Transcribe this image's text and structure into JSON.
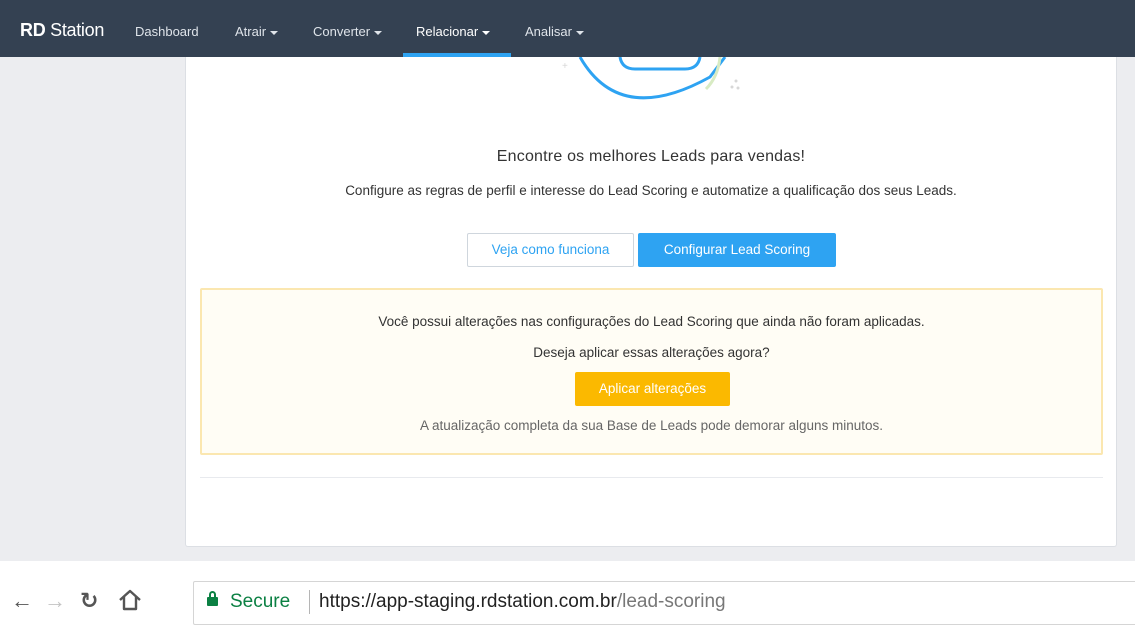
{
  "nav": {
    "brand_bold": "RD",
    "brand_rest": "Station",
    "items": [
      {
        "label": "Dashboard",
        "dropdown": false
      },
      {
        "label": "Atrair",
        "dropdown": true
      },
      {
        "label": "Converter",
        "dropdown": true
      },
      {
        "label": "Relacionar",
        "dropdown": true,
        "active": true
      },
      {
        "label": "Analisar",
        "dropdown": true
      }
    ]
  },
  "main": {
    "headline": "Encontre os melhores Leads para vendas!",
    "subline": "Configure as regras de perfil e interesse do Lead Scoring e automatize a qualificação dos seus Leads.",
    "see_how_label": "Veja como funciona",
    "configure_label": "Configurar Lead Scoring"
  },
  "warning": {
    "line1": "Você possui alterações nas configurações do Lead Scoring que ainda não foram aplicadas.",
    "line2": "Deseja aplicar essas alterações agora?",
    "apply_label": "Aplicar alterações",
    "line3": "A atualização completa da sua Base de Leads pode demorar alguns minutos."
  },
  "browser": {
    "secure_label": "Secure",
    "url_scheme": "https://",
    "url_host": "app-staging.rdstation.com.br",
    "url_path": "/lead-scoring",
    "icons": [
      "back-arrow-icon",
      "forward-arrow-icon",
      "reload-icon",
      "home-icon",
      "lock-icon"
    ]
  },
  "colors": {
    "navbar": "#344152",
    "accent_blue": "#2ea3f2",
    "warning_yellow": "#fbb900",
    "secure_green": "#0b8043"
  }
}
